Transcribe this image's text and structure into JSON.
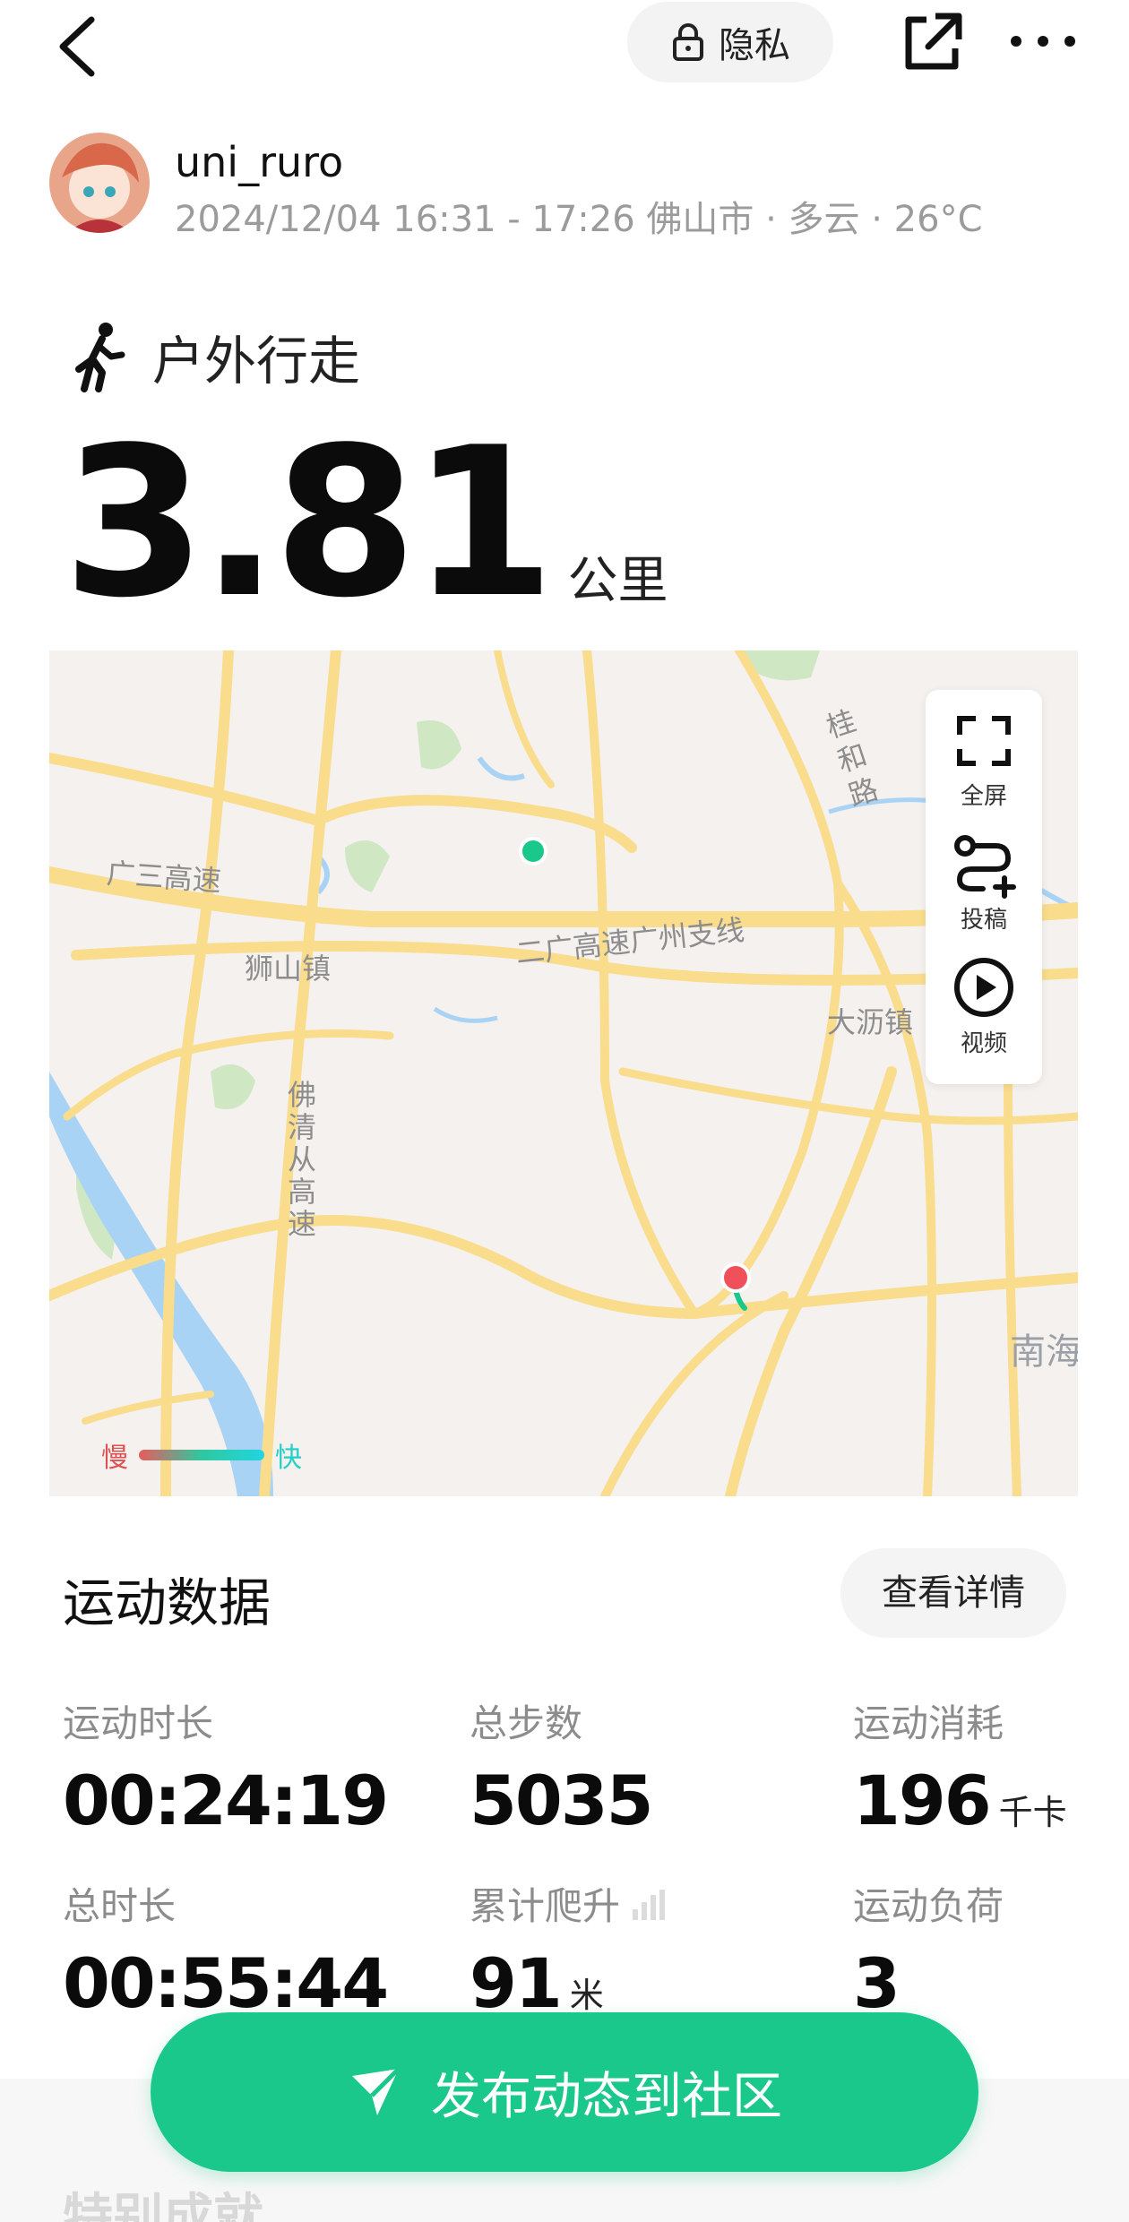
{
  "header": {
    "privacy_label": "隐私"
  },
  "user": {
    "name": "uni_ruro",
    "meta": "2024/12/04 16:31 - 17:26 佛山市 · 多云 · 26°C"
  },
  "activity": {
    "type": "户外行走",
    "distance": "3.81",
    "distance_unit": "公里"
  },
  "map": {
    "tools": [
      {
        "label": "全屏",
        "icon": "fullscreen-icon"
      },
      {
        "label": "投稿",
        "icon": "route-add-icon"
      },
      {
        "label": "视频",
        "icon": "play-icon"
      }
    ],
    "places": {
      "guangsan": "广三高速",
      "shishan": "狮山镇",
      "erguang": "二广高速广州支线",
      "dali": "大沥镇",
      "guihe": "桂和路",
      "foqing": "佛清从高速",
      "nanhai": "南海"
    },
    "legend": {
      "slow": "慢",
      "fast": "快"
    },
    "colors": {
      "road": "#f9dc8c",
      "water": "#a9d3f5",
      "green": "#cfe8c3",
      "start": "#19c88a",
      "end": "#f0505a"
    }
  },
  "stats": {
    "title": "运动数据",
    "detail_button": "查看详情",
    "items": [
      {
        "label": "运动时长",
        "value": "00:24:19",
        "unit": ""
      },
      {
        "label": "总步数",
        "value": "5035",
        "unit": ""
      },
      {
        "label": "运动消耗",
        "value": "196",
        "unit": "千卡"
      },
      {
        "label": "总时长",
        "value": "00:55:44",
        "unit": ""
      },
      {
        "label": "累计爬升",
        "value": "91",
        "unit": "米"
      },
      {
        "label": "运动负荷",
        "value": "3",
        "unit": ""
      }
    ]
  },
  "footer": {
    "publish_label": "发布动态到社区",
    "next_section": "特别成就"
  }
}
